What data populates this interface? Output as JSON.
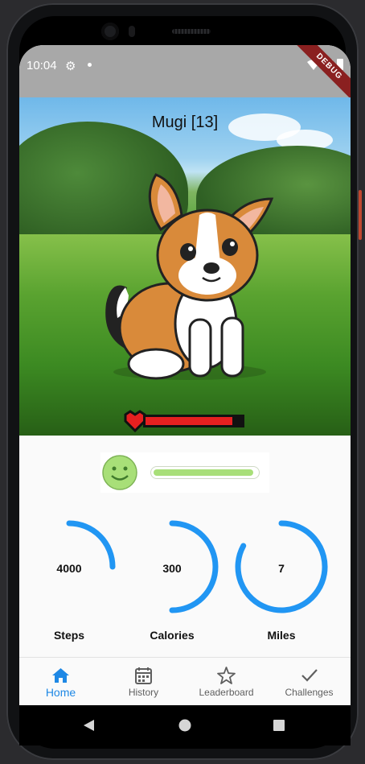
{
  "status_bar": {
    "time": "10:04",
    "debug_banner": "DEBUG"
  },
  "pet": {
    "name": "Mugi [13]",
    "health": 0.9
  },
  "mood": {
    "level": 0.97
  },
  "stats": [
    {
      "id": "steps",
      "value": "4000",
      "label": "Steps",
      "progress": 0.25
    },
    {
      "id": "calories",
      "value": "300",
      "label": "Calories",
      "progress": 0.5
    },
    {
      "id": "miles",
      "value": "7",
      "label": "Miles",
      "progress": 0.83
    }
  ],
  "nav": {
    "items": [
      {
        "label": "Home",
        "icon": "home-icon",
        "active": true
      },
      {
        "label": "History",
        "icon": "calendar-icon",
        "active": false
      },
      {
        "label": "Leaderboard",
        "icon": "star-icon",
        "active": false
      },
      {
        "label": "Challenges",
        "icon": "check-icon",
        "active": false
      }
    ]
  },
  "colors": {
    "accent": "#1e88e5",
    "ring": "#2196f3",
    "health": "#e62020",
    "mood": "#a8df78"
  }
}
